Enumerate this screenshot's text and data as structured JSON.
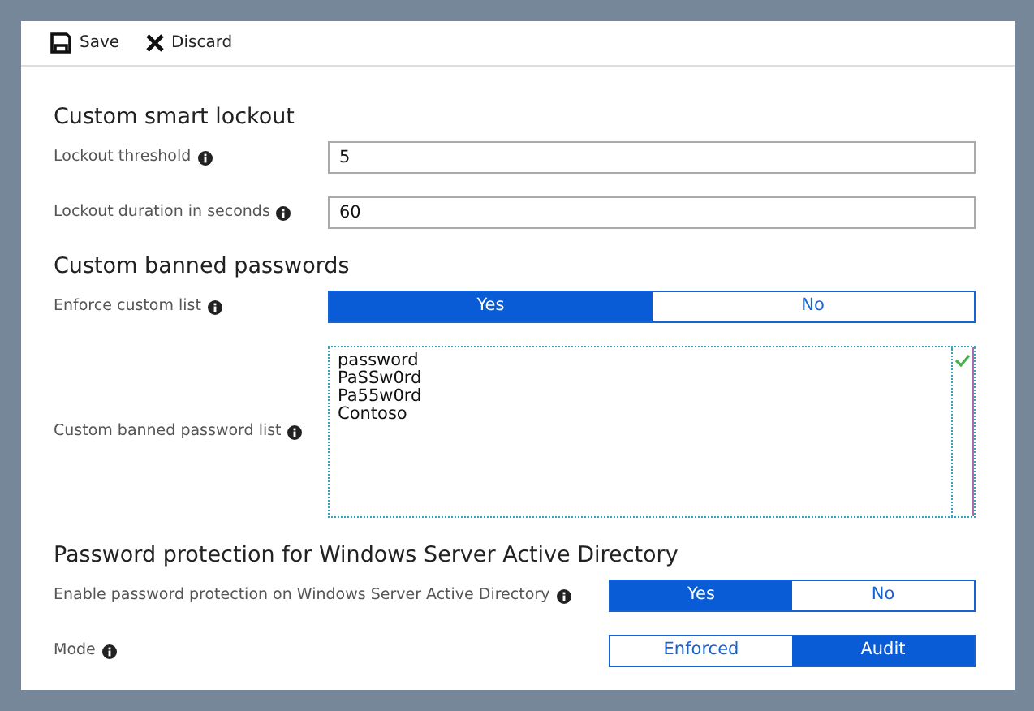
{
  "toolbar": [
    {
      "kind": "save",
      "label": "Save"
    },
    {
      "kind": "discard",
      "label": "Discard"
    }
  ],
  "sections": [
    {
      "title": "Custom smart lockout",
      "fields": [
        {
          "kind": "text",
          "label": "Lockout threshold",
          "value": "5"
        },
        {
          "kind": "text",
          "label": "Lockout duration in seconds",
          "value": "60"
        }
      ]
    },
    {
      "title": "Custom banned passwords",
      "fields": [
        {
          "kind": "toggle",
          "label": "Enforce custom list",
          "options": [
            {
              "label": "Yes",
              "selected": true
            },
            {
              "label": "No",
              "selected": false
            }
          ]
        },
        {
          "kind": "list",
          "label": "Custom banned password list",
          "lines": [
            "password",
            "PaSSw0rd",
            "Pa55w0rd",
            "Contoso"
          ],
          "valid": true
        }
      ]
    },
    {
      "title": "Password protection for Windows Server Active Directory",
      "fields": [
        {
          "kind": "narrow-toggle",
          "label": "Enable password protection on Windows Server Active Directory",
          "options": [
            {
              "label": "Yes",
              "selected": true
            },
            {
              "label": "No",
              "selected": false
            }
          ]
        },
        {
          "kind": "narrow-toggle",
          "label": "Mode",
          "options": [
            {
              "label": "Enforced",
              "selected": false
            },
            {
              "label": "Audit",
              "selected": true
            }
          ]
        }
      ]
    }
  ]
}
